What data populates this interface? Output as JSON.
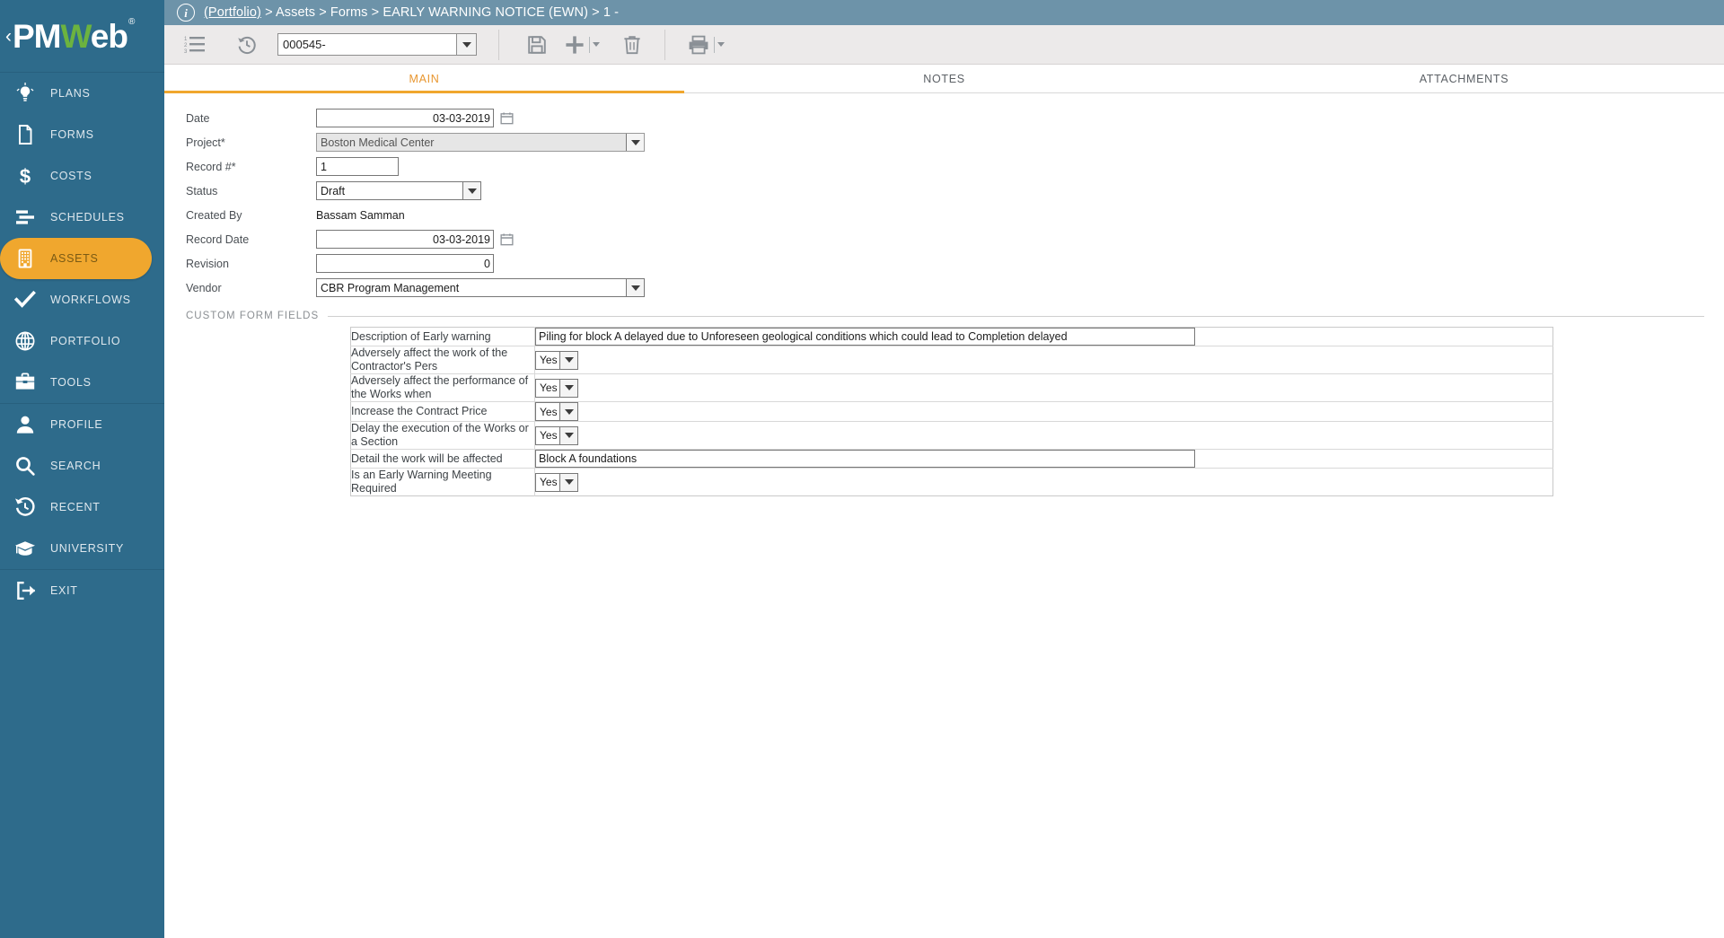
{
  "brand": {
    "name_pm": "PM",
    "name_w": "W",
    "name_eb": "eb",
    "registered": "®",
    "collapse_chevron": "‹",
    "accent_orange": "#f0a72e",
    "sidebar_blue": "#2e6b8b",
    "green": "#6cb33f"
  },
  "sidebar": {
    "items": [
      {
        "label": "PLANS",
        "icon": "lightbulb-icon",
        "active": false
      },
      {
        "label": "FORMS",
        "icon": "document-icon",
        "active": false
      },
      {
        "label": "COSTS",
        "icon": "dollar-icon",
        "active": false
      },
      {
        "label": "SCHEDULES",
        "icon": "gantt-icon",
        "active": false
      },
      {
        "label": "ASSETS",
        "icon": "building-icon",
        "active": true
      },
      {
        "label": "WORKFLOWS",
        "icon": "check-icon",
        "active": false
      },
      {
        "label": "PORTFOLIO",
        "icon": "globe-icon",
        "active": false
      },
      {
        "label": "TOOLS",
        "icon": "toolbox-icon",
        "active": false
      }
    ],
    "items2": [
      {
        "label": "PROFILE",
        "icon": "person-icon"
      },
      {
        "label": "SEARCH",
        "icon": "magnifier-icon"
      },
      {
        "label": "RECENT",
        "icon": "history-icon"
      },
      {
        "label": "UNIVERSITY",
        "icon": "graduation-cap-icon"
      }
    ],
    "items3": [
      {
        "label": "EXIT",
        "icon": "exit-icon"
      }
    ]
  },
  "breadcrumb": {
    "info_glyph": "i",
    "link": "(Portfolio)",
    "trail": " > Assets > Forms > EARLY WARNING NOTICE (EWN) > 1 -"
  },
  "toolbar": {
    "list_icon": "numbered-list-icon",
    "history_icon": "history-icon",
    "record_select_value": "000545-",
    "save_icon": "save-icon",
    "add_icon": "plus-icon",
    "delete_icon": "trash-icon",
    "print_icon": "printer-icon"
  },
  "tabs": [
    {
      "label": "MAIN",
      "active": true
    },
    {
      "label": "NOTES",
      "active": false
    },
    {
      "label": "ATTACHMENTS",
      "active": false
    }
  ],
  "form": {
    "date_label": "Date",
    "date_value": "03-03-2019",
    "project_label": "Project*",
    "project_value": "Boston Medical Center",
    "record_label": "Record #*",
    "record_value": "1",
    "status_label": "Status",
    "status_value": "Draft",
    "created_by_label": "Created By",
    "created_by_value": "Bassam Samman",
    "record_date_label": "Record Date",
    "record_date_value": "03-03-2019",
    "revision_label": "Revision",
    "revision_value": "0",
    "vendor_label": "Vendor",
    "vendor_value": "CBR Program Management"
  },
  "custom_fields": {
    "section_title": "CUSTOM FORM FIELDS",
    "rows": [
      {
        "label": "Description of Early warning",
        "type": "text",
        "value": "Piling for block A delayed due to Unforeseen geological conditions which could lead to Completion delayed"
      },
      {
        "label": "Adversely affect the work of the Contractor's Pers",
        "type": "select",
        "value": "Yes"
      },
      {
        "label": "Adversely affect the performance of the Works when",
        "type": "select",
        "value": "Yes"
      },
      {
        "label": "Increase the Contract Price",
        "type": "select",
        "value": "Yes"
      },
      {
        "label": "Delay the execution of the Works or a Section",
        "type": "select",
        "value": "Yes"
      },
      {
        "label": "Detail the work will be affected",
        "type": "text",
        "value": "Block A foundations"
      },
      {
        "label": "Is an Early Warning Meeting Required",
        "type": "select",
        "value": "Yes"
      }
    ]
  }
}
